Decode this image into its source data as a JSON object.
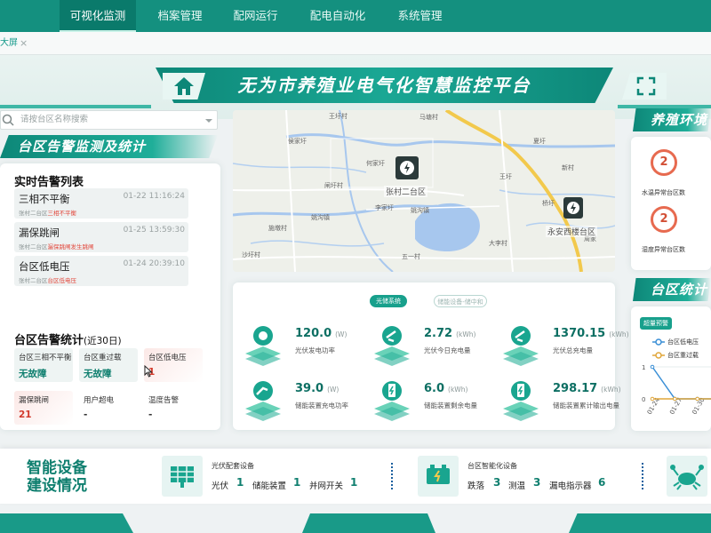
{
  "nav": {
    "items": [
      "可视化监测",
      "档案管理",
      "配网运行",
      "配电自动化",
      "系统管理"
    ]
  },
  "tab": {
    "label": "大屏",
    "close": "×"
  },
  "page": {
    "title": "无为市养殖业电气化智慧监控平台"
  },
  "search": {
    "placeholder": "请按台区名称搜索"
  },
  "alarm_section": {
    "title": "台区告警监测及统计",
    "list_title": "实时告警列表",
    "items": [
      {
        "title": "三相不平衡",
        "time": "01-22 11:16:24",
        "desc_prefix": "张村二台区",
        "desc_highlight": "三相不平衡"
      },
      {
        "title": "漏保跳闸",
        "time": "01-25 13:59:30",
        "desc_prefix": "张村二台区",
        "desc_highlight": "漏保跳闸发生跳闸"
      },
      {
        "title": "台区低电压",
        "time": "01-24 20:39:10",
        "desc_prefix": "张村二台区",
        "desc_highlight": "台区低电压"
      }
    ],
    "stats_title": "台区告警统计",
    "stats_period": "(近30日)",
    "stats": [
      {
        "label": "台区三相不平衡",
        "value": "无故障",
        "color": "#0f7f6f",
        "bg": "#eef4f3"
      },
      {
        "label": "台区重过载",
        "value": "无故障",
        "color": "#0f7f6f",
        "bg": "#eef4f3"
      },
      {
        "label": "台区低电压",
        "value": "1",
        "color": "#d23a2c",
        "bg": "#fbe8e6"
      },
      {
        "label": "漏保跳闸",
        "value": "21",
        "color": "#d23a2c",
        "bg": "#fbe8e6"
      },
      {
        "label": "用户超电",
        "value": "-",
        "color": "#333333",
        "bg": "#ffffff"
      },
      {
        "label": "温度告警",
        "value": "-",
        "color": "#333333",
        "bg": "#ffffff"
      }
    ]
  },
  "map": {
    "markers": [
      {
        "label": "张村二台区"
      },
      {
        "label": "永安西楼台区"
      }
    ],
    "labels": [
      "马塘村",
      "王圩村",
      "侯家圩",
      "夏圩",
      "闸圩村",
      "姚沟镇",
      "李家圩",
      "姚沟镇",
      "施墩村",
      "五一村",
      "大李村",
      "桥圩",
      "新村",
      "沙圩村",
      "何家圩",
      "王圩",
      "周家"
    ]
  },
  "energy": {
    "pills": [
      "光储系统",
      "储能设备-储中和"
    ],
    "metrics": [
      {
        "value": "120.0",
        "unit": "(W)",
        "label": "光伏发电功率",
        "icon": "sun-panel-icon"
      },
      {
        "value": "2.72",
        "unit": "(kWh)",
        "label": "光伏今日充电量",
        "icon": "plug-icon"
      },
      {
        "value": "1370.15",
        "unit": "(kWh)",
        "label": "光伏总充电量",
        "icon": "plug-icon"
      },
      {
        "value": "39.0",
        "unit": "(W)",
        "label": "储能装置充电功率",
        "icon": "charge-plug-icon"
      },
      {
        "value": "6.0",
        "unit": "(kWh)",
        "label": "储能装置剩余电量",
        "icon": "battery-icon"
      },
      {
        "value": "298.17",
        "unit": "(kWh)",
        "label": "储能装置累计输出电量",
        "icon": "battery-icon"
      }
    ]
  },
  "env": {
    "title": "养殖环境",
    "items": [
      {
        "value": "2",
        "label": "水温异常台区数"
      },
      {
        "value": "2",
        "label": "湿度异常台区数"
      }
    ]
  },
  "area_stats": {
    "title": "台区统计",
    "tag": "超量预警",
    "legend": [
      "台区低电压",
      "台区重过载"
    ],
    "chart_data": {
      "type": "line",
      "categories": [
        "01-24",
        "01-27",
        "01-30",
        "02-02"
      ],
      "series": [
        {
          "name": "台区低电压",
          "values": [
            1,
            0,
            0,
            0
          ]
        },
        {
          "name": "台区重过载",
          "values": [
            0,
            0,
            0,
            0
          ]
        }
      ],
      "yticks": [
        "0",
        "1"
      ],
      "colors": [
        "#3a8fd6",
        "#e0a63a"
      ]
    }
  },
  "devices": {
    "title_line1": "智能设备",
    "title_line2": "建设情况",
    "group1": {
      "title": "光伏配套设备",
      "items": [
        {
          "name": "光伏",
          "count": "1"
        },
        {
          "name": "储能装置",
          "count": "1"
        },
        {
          "name": "并网开关",
          "count": "1"
        }
      ]
    },
    "group2": {
      "title": "台区智能化设备",
      "items": [
        {
          "name": "跌落",
          "count": "3"
        },
        {
          "name": "测温",
          "count": "3"
        },
        {
          "name": "漏电指示器",
          "count": "6"
        }
      ]
    }
  },
  "colors": {
    "primary": "#14907f",
    "dark": "#0d8778",
    "alert": "#d23a2c"
  }
}
